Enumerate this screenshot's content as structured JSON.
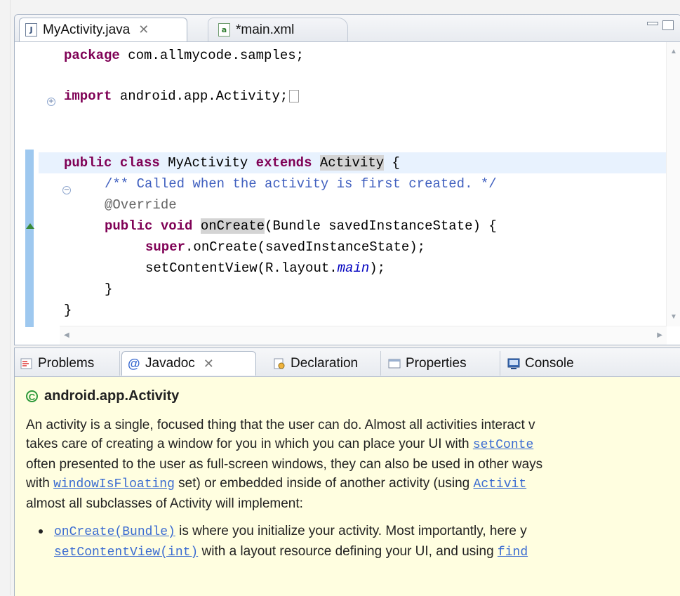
{
  "editor": {
    "tabs": [
      {
        "label": "MyActivity.java",
        "icon": "java-file-icon",
        "close": "✕"
      },
      {
        "label": "*main.xml",
        "icon": "xml-file-icon"
      }
    ],
    "code_lines": {
      "l1_kw": "package",
      "l1_rest": " com.allmycode.samples;",
      "l2_kw": "import",
      "l2_rest": " android.app.Activity;",
      "l3_kw1": "public",
      "l3_kw2": "class",
      "l3_name": " MyActivity ",
      "l3_kw3": "extends",
      "l3_sp": " ",
      "l3_mark": "Activity",
      "l3_end": " {",
      "l4_comment": "/** Called when the activity is first created. */",
      "l5_annot": "@Override",
      "l6_kw1": "public",
      "l6_kw2": "void",
      "l6_mark": "onCreate",
      "l6_rest": "(Bundle savedInstanceState) {",
      "l7_kw": "super",
      "l7_rest": ".onCreate(savedInstanceState);",
      "l8_pre": "setContentView(R.layout.",
      "l8_it": "main",
      "l8_post": ");",
      "l9": "}",
      "l10": "}"
    }
  },
  "views": {
    "tabs": [
      {
        "label": "Problems",
        "icon": "problems-icon"
      },
      {
        "label": "Javadoc",
        "icon": "javadoc-icon",
        "close": "✕"
      },
      {
        "label": "Declaration",
        "icon": "declaration-icon"
      },
      {
        "label": "Properties",
        "icon": "properties-icon"
      },
      {
        "label": "Console",
        "icon": "console-icon"
      }
    ],
    "javadoc": {
      "title": "android.app.Activity",
      "p1": "An activity is a single, focused thing that the user can do. Almost all activities interact v",
      "p2a": "takes care of creating a window for you in which you can place your UI with ",
      "p2link": "setConte",
      "p3": "often presented to the user as full-screen windows, they can also be used in other ways",
      "p4a": "with ",
      "p4link": "windowIsFloating",
      "p4b": " set) or embedded inside of another activity (using ",
      "p4link2": "Activit",
      "p5": "almost all subclasses of Activity will implement:",
      "b1link": "onCreate(Bundle)",
      "b1text": " is where you initialize your activity. Most importantly, here y",
      "b2link": "setContentView(int)",
      "b2text": " with a layout resource defining your UI, and using ",
      "b2link2": "find"
    }
  },
  "colors": {
    "keyword": "#7f0055",
    "comment": "#3f5fbf",
    "link": "#3a6bd1",
    "javadoc_bg": "#fffee0",
    "highlight_line": "#e8f2fe"
  }
}
